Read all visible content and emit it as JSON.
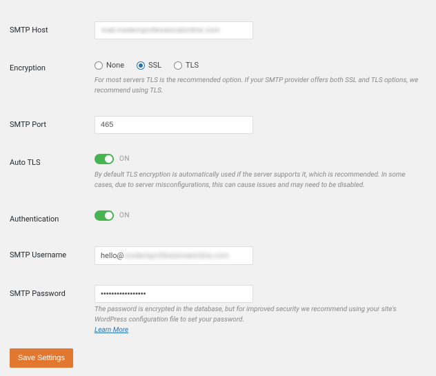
{
  "fields": {
    "smtp_host": {
      "label": "SMTP Host",
      "value": "mail.modemprofessionalonline.com"
    },
    "encryption": {
      "label": "Encryption",
      "options": {
        "none": "None",
        "ssl": "SSL",
        "tls": "TLS"
      },
      "selected": "ssl",
      "description": "For most servers TLS is the recommended option. If your SMTP provider offers both SSL and TLS options, we recommend using TLS."
    },
    "smtp_port": {
      "label": "SMTP Port",
      "value": "465"
    },
    "auto_tls": {
      "label": "Auto TLS",
      "state_label": "ON",
      "description": "By default TLS encryption is automatically used if the server supports it, which is recommended. In some cases, due to server misconfigurations, this can cause issues and may need to be disabled."
    },
    "authentication": {
      "label": "Authentication",
      "state_label": "ON"
    },
    "smtp_username": {
      "label": "SMTP Username",
      "value_prefix": "hello@",
      "value_blurred": "modemprofessionalonline.com"
    },
    "smtp_password": {
      "label": "SMTP Password",
      "value": "•••••••••••••••••",
      "description": "The password is encrypted in the database, but for improved security we recommend using your site's WordPress configuration file to set your password.",
      "learn_more": "Learn More"
    }
  },
  "actions": {
    "save": "Save Settings"
  }
}
